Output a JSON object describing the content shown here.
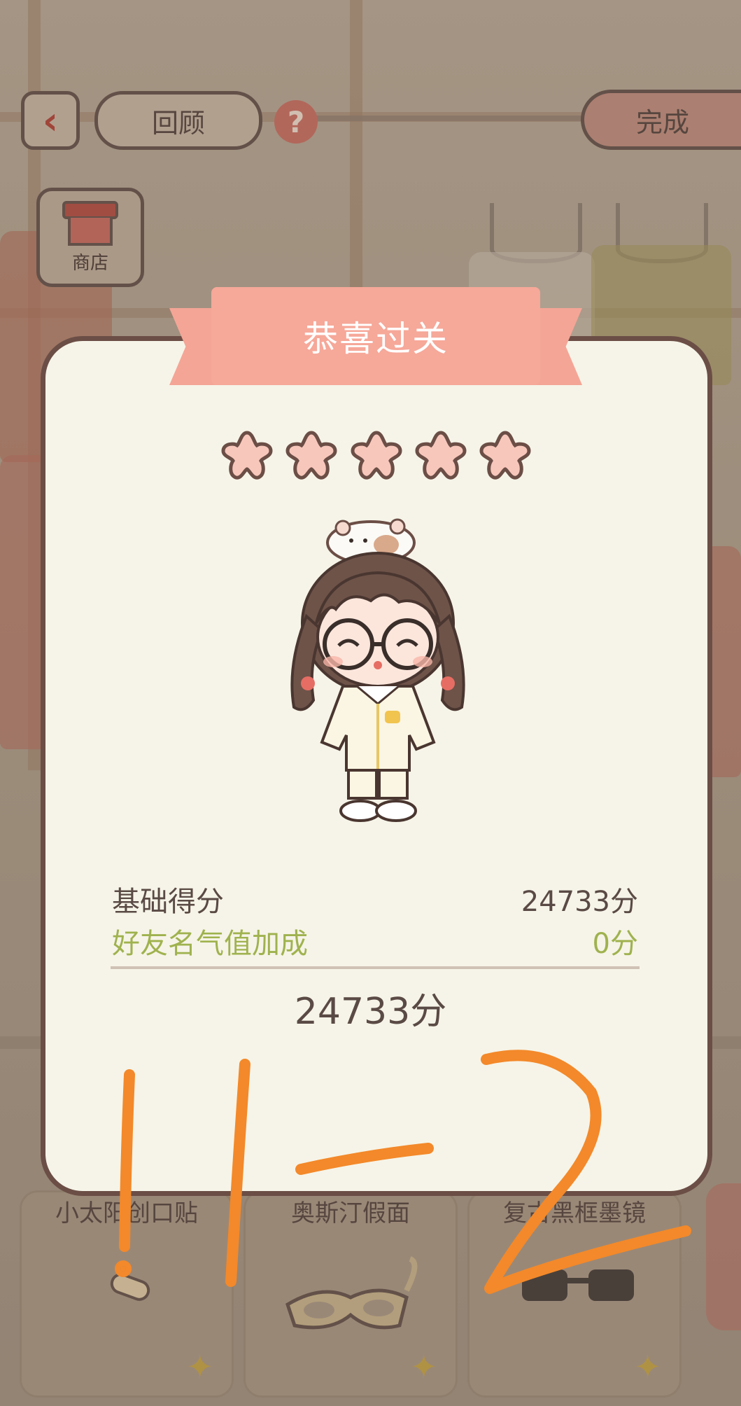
{
  "header": {
    "back_icon": "chevron-left-icon",
    "review_label": "回顾",
    "help_label": "?",
    "done_label": "完成"
  },
  "shop": {
    "icon": "shop-icon",
    "label": "商店"
  },
  "dialog": {
    "title": "恭喜过关",
    "stars": {
      "earned": 5,
      "total": 5
    },
    "base_label": "基础得分",
    "base_value": "24733分",
    "bonus_label": "好友名气值加成",
    "bonus_value": "0分",
    "total_value": "24733分"
  },
  "items": [
    {
      "name": "小太阳创口贴",
      "icon": "bandage-icon"
    },
    {
      "name": "奥斯汀假面",
      "icon": "mask-icon"
    },
    {
      "name": "复古黑框墨镜",
      "icon": "sunglasses-icon"
    }
  ],
  "annotation": {
    "handwritten": "11-2"
  },
  "colors": {
    "accent_banner": "#f6a899",
    "star_fill": "#f8c7bb",
    "bonus_green": "#9fb24e",
    "scribble_orange": "#f3892a",
    "dialog_bg": "#f6f4e8"
  }
}
